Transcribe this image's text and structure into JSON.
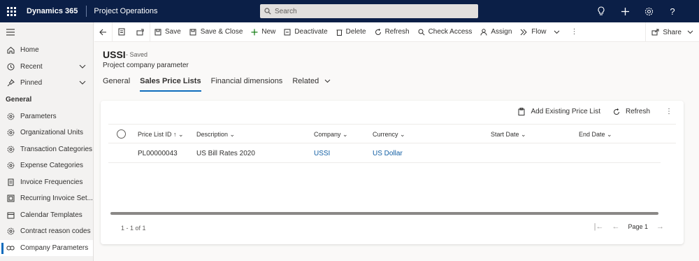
{
  "topbar": {
    "app_name": "Dynamics 365",
    "module_name": "Project Operations",
    "search_placeholder": "Search"
  },
  "sidebar": {
    "nav": [
      {
        "label": "Home",
        "icon": "home-icon"
      },
      {
        "label": "Recent",
        "icon": "clock-icon"
      },
      {
        "label": "Pinned",
        "icon": "pin-icon"
      }
    ],
    "group_label": "General",
    "items": [
      {
        "label": "Parameters",
        "icon": "gear-icon"
      },
      {
        "label": "Organizational Units",
        "icon": "gear-icon"
      },
      {
        "label": "Transaction Categories",
        "icon": "gear-icon"
      },
      {
        "label": "Expense Categories",
        "icon": "gear-icon"
      },
      {
        "label": "Invoice Frequencies",
        "icon": "document-icon"
      },
      {
        "label": "Recurring Invoice Set...",
        "icon": "document-icon"
      },
      {
        "label": "Calendar Templates",
        "icon": "calendar-icon"
      },
      {
        "label": "Contract reason codes",
        "icon": "gear-icon"
      },
      {
        "label": "Company Parameters",
        "icon": "link-icon"
      }
    ]
  },
  "commandbar": {
    "save": "Save",
    "save_close": "Save & Close",
    "new": "New",
    "deactivate": "Deactivate",
    "delete": "Delete",
    "refresh": "Refresh",
    "check_access": "Check Access",
    "assign": "Assign",
    "flow": "Flow",
    "share": "Share"
  },
  "record": {
    "title": "USSI",
    "saved_status": "- Saved",
    "entity": "Project company parameter"
  },
  "tabs": [
    "General",
    "Sales Price Lists",
    "Financial dimensions",
    "Related"
  ],
  "subgrid": {
    "add_existing": "Add Existing Price List",
    "refresh": "Refresh",
    "columns": {
      "price_list_id": "Price List ID",
      "description": "Description",
      "company": "Company",
      "currency": "Currency",
      "start_date": "Start Date",
      "end_date": "End Date"
    },
    "rows": [
      {
        "price_list_id": "PL00000043",
        "description": "US Bill Rates 2020",
        "company": "USSI",
        "currency": "US Dollar",
        "start_date": "",
        "end_date": ""
      }
    ],
    "count": "1 - 1 of 1",
    "page": "Page 1"
  }
}
